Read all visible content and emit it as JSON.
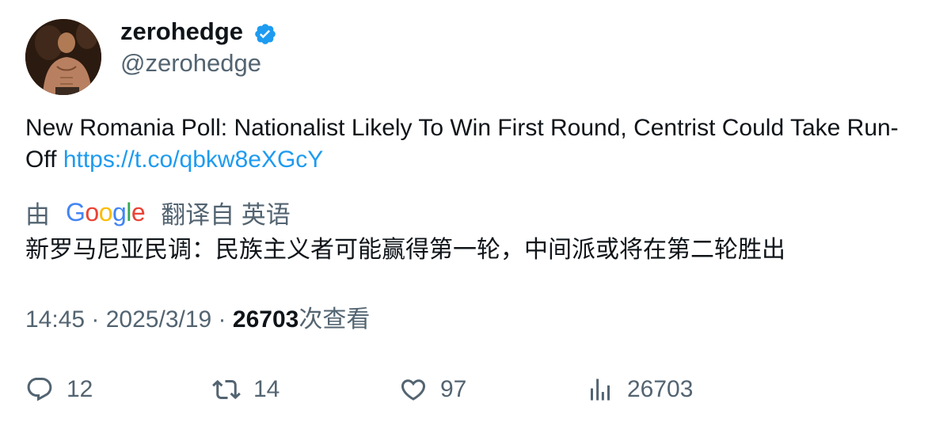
{
  "user": {
    "display_name": "zerohedge",
    "handle": "@zerohedge",
    "verified": true
  },
  "tweet": {
    "text": "New Romania Poll: Nationalist Likely To Win First Round, Centrist Could Take Run-Off ",
    "link": "https://t.co/qbkw8eXGcY"
  },
  "translation": {
    "prefix": "由",
    "provider_letters": [
      "G",
      "o",
      "o",
      "g",
      "l",
      "e"
    ],
    "suffix": "翻译自 英语",
    "text": "新罗马尼亚民调：民族主义者可能赢得第一轮，中间派或将在第二轮胜出"
  },
  "meta": {
    "time": "14:45",
    "sep1": " · ",
    "date": "2025/3/19",
    "sep2": " · ",
    "views_count": "26703",
    "views_label": "次查看"
  },
  "actions": {
    "reply_icon": "reply-icon",
    "reply_count": "12",
    "retweet_icon": "retweet-icon",
    "retweet_count": "14",
    "like_icon": "heart-icon",
    "like_count": "97",
    "views_icon": "views-chart-icon",
    "views_count": "26703"
  },
  "colors": {
    "link": "#1d9bf0",
    "secondary_text": "#536471",
    "primary_text": "#0f1419",
    "verified_badge": "#1d9bf0"
  }
}
